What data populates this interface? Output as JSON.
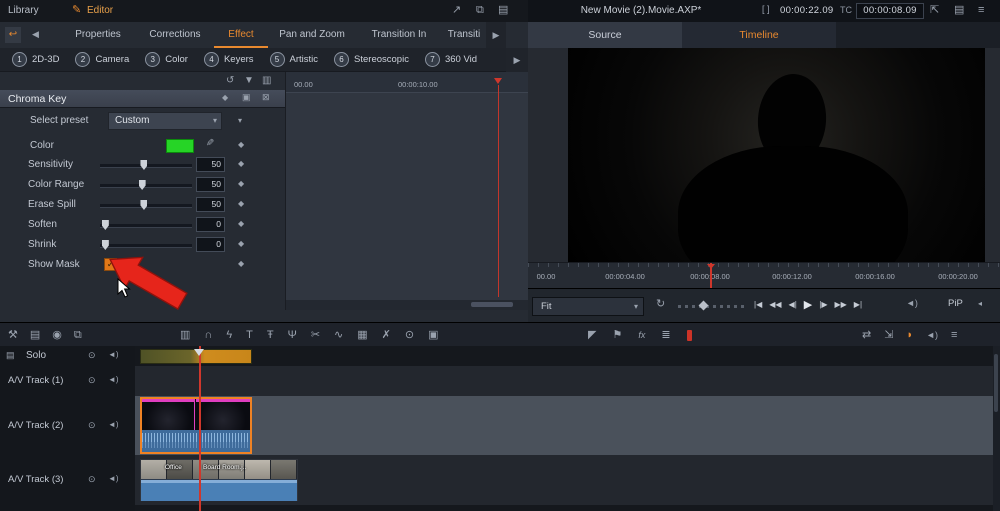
{
  "topbar": {
    "library": "Library",
    "editor": "Editor",
    "project_title": "New Movie (2).Movie.AXP*",
    "duration": "00:00:22.09",
    "tc_label": "TC",
    "timecode": "00:00:08.09"
  },
  "icons": {
    "pencil": "✎",
    "send": "↗",
    "copy": "⧉",
    "panel": "▤",
    "menu": "≡",
    "undo_corner": "↩",
    "chev_left": "◀",
    "chev_right": "▶",
    "undo": "↺",
    "save": "▼",
    "save_as": "▥",
    "diamond": "◆",
    "image": "▣",
    "reset": "⊠",
    "dropper": "✎",
    "dropdown": "▾",
    "loop": "↻",
    "volume": "◄)",
    "eye": "⊙",
    "speaker": "◄)",
    "list": "▤",
    "brackets": "[ ]",
    "check": "✓",
    "pip_arrow": "◂",
    "export": "⇱"
  },
  "effect_panel": {
    "tabs": [
      "Properties",
      "Corrections",
      "Effect",
      "Pan and Zoom",
      "Transition In",
      "Transiti"
    ],
    "categories": [
      {
        "n": "1",
        "label": "2D-3D"
      },
      {
        "n": "2",
        "label": "Camera"
      },
      {
        "n": "3",
        "label": "Color"
      },
      {
        "n": "4",
        "label": "Keyers"
      },
      {
        "n": "5",
        "label": "Artistic"
      },
      {
        "n": "6",
        "label": "Stereoscopic"
      },
      {
        "n": "7",
        "label": "360 Vid"
      }
    ],
    "title": "Chroma Key",
    "preset_label": "Select preset",
    "preset_value": "Custom",
    "color_label": "Color",
    "sliders": [
      {
        "label": "Sensitivity",
        "value": "50"
      },
      {
        "label": "Color Range",
        "value": "50"
      },
      {
        "label": "Erase Spill",
        "value": "50"
      },
      {
        "label": "Soften",
        "value": "0"
      },
      {
        "label": "Shrink",
        "value": "0"
      }
    ],
    "show_mask": "Show Mask",
    "kf_tick_a": "00.00",
    "kf_tick_b": "00:00:10.00"
  },
  "preview": {
    "source_tab": "Source",
    "timeline_tab": "Timeline",
    "ruler": [
      "00.00",
      "00:00:04.00",
      "00:00:08.00",
      "00:00:12.00",
      "00:00:16.00",
      "00:00:20.00"
    ],
    "fit": "Fit",
    "transport": [
      "|◀",
      "◀◀",
      "◀|",
      "▶",
      "|▶",
      "▶▶",
      "▶|"
    ],
    "pip": "PiP"
  },
  "toolbar": {
    "left": [
      "⚒",
      "▤",
      "◉",
      "⧉"
    ],
    "center": [
      "▥",
      "∩",
      "ϟ",
      "T",
      "Ŧ",
      "Ψ",
      "✂",
      "∿",
      "▦",
      "✗",
      "⊙",
      "▣"
    ],
    "markers": [
      "◤",
      "⚑",
      "fx",
      "≣"
    ],
    "right": [
      "⇄",
      "⇲",
      "◗",
      "◄)",
      "≡"
    ]
  },
  "timeline": {
    "tracks": [
      "Solo",
      "A/V Track (1)",
      "A/V Track (2)",
      "A/V Track (3)"
    ],
    "clips": {
      "office": "Office",
      "board": "Board Room.j.."
    }
  },
  "colors": {
    "accent": "#e8892f",
    "chroma_green": "#26d426",
    "playhead_red": "#cf372c",
    "clip_blue": "#4a80b6",
    "clip_magenta": "#e03ec0",
    "selection_orange": "#ef8224"
  }
}
